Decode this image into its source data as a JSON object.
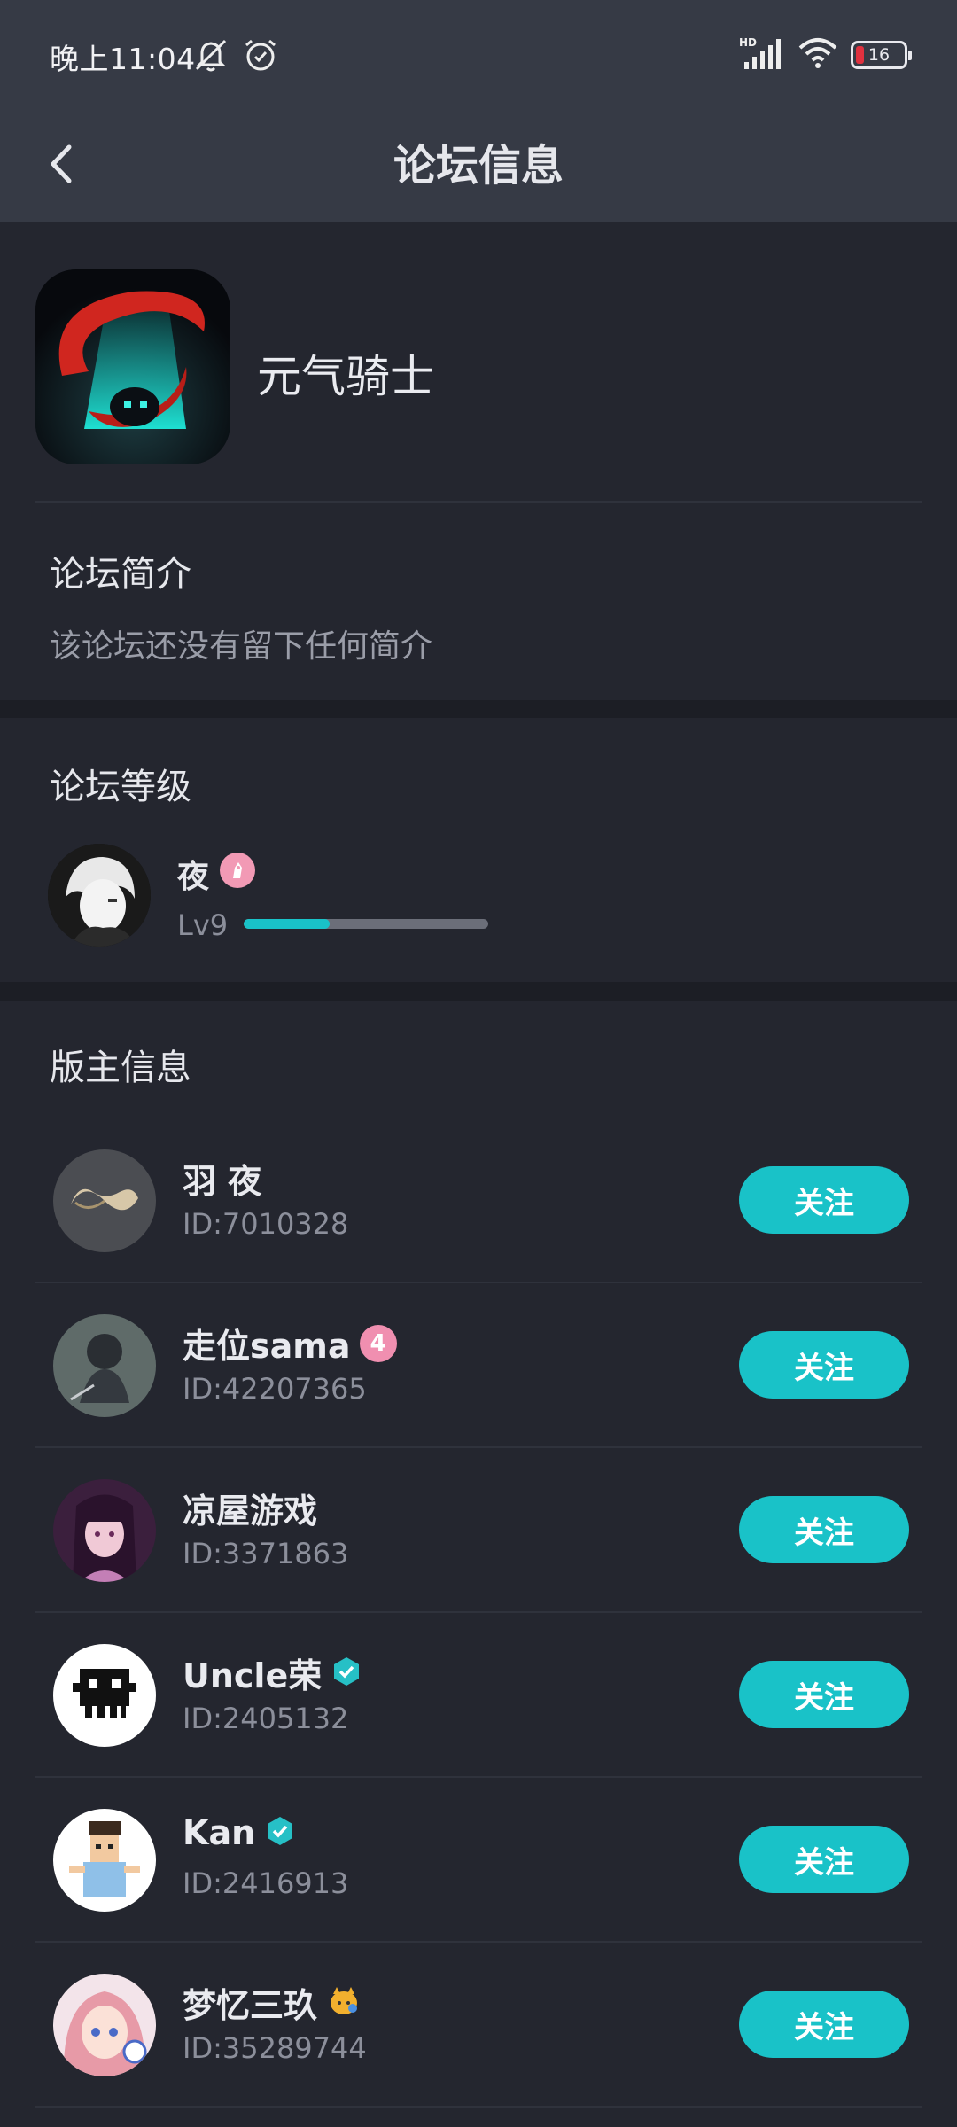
{
  "status_bar": {
    "time": "晚上11:04",
    "battery_level": "16",
    "network_label": "HD",
    "icons": [
      "mute-icon",
      "alarm-icon",
      "signal-icon",
      "wifi-icon",
      "battery-icon"
    ]
  },
  "header": {
    "title": "论坛信息"
  },
  "forum": {
    "name": "元气骑士",
    "intro_title": "论坛简介",
    "intro_text": "该论坛还没有留下任何简介"
  },
  "level": {
    "section_title": "论坛等级",
    "user_name": "夜",
    "level_label": "Lv9",
    "progress": 0.35
  },
  "moderators": {
    "section_title": "版主信息",
    "follow_label": "关注",
    "items": [
      {
        "name": "羽 夜",
        "id": "ID:7010328",
        "badge": null
      },
      {
        "name": "走位sama",
        "id": "ID:42207365",
        "badge": "4"
      },
      {
        "name": "凉屋游戏",
        "id": "ID:3371863",
        "badge": null
      },
      {
        "name": "Uncle荣",
        "id": "ID:2405132",
        "badge": "verified"
      },
      {
        "name": "Kan",
        "id": "ID:2416913",
        "badge": "verified"
      },
      {
        "name": "梦忆三玖",
        "id": "ID:35289744",
        "badge": "emoji"
      }
    ]
  },
  "colors": {
    "accent": "#19c2c8",
    "background": "#24262f",
    "header": "#363a45",
    "badge_pink": "#f29ab5"
  }
}
